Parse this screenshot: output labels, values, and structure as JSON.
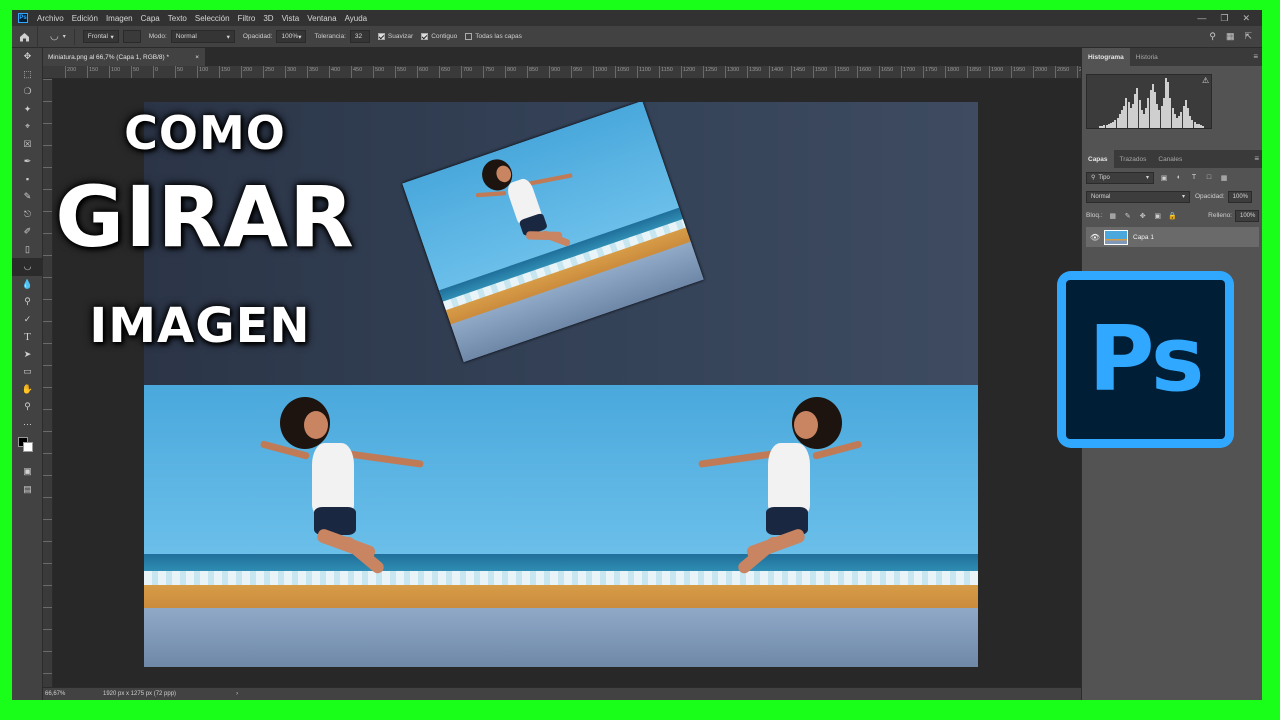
{
  "menubar": {
    "items": [
      "Archivo",
      "Edición",
      "Imagen",
      "Capa",
      "Texto",
      "Selección",
      "Filtro",
      "3D",
      "Vista",
      "Ventana",
      "Ayuda"
    ]
  },
  "options": {
    "mode_source": "Frontal",
    "mode_label": "Modo:",
    "mode_value": "Normal",
    "opacity_label": "Opacidad:",
    "opacity_value": "100%",
    "tolerance_label": "Tolerancia:",
    "tolerance_value": "32",
    "smooth_label": "Suavizar",
    "contiguous_label": "Contiguo",
    "all_layers_label": "Todas las capas"
  },
  "document": {
    "tab_title": "Miniatura.png al 66,7% (Capa 1, RGB/8) *",
    "tab_close": "×"
  },
  "ruler": {
    "ticks": [
      "200",
      "150",
      "100",
      "50",
      "0",
      "50",
      "100",
      "150",
      "200",
      "250",
      "300",
      "350",
      "400",
      "450",
      "500",
      "550",
      "600",
      "650",
      "700",
      "750",
      "800",
      "850",
      "900",
      "950",
      "1000",
      "1050",
      "1100",
      "1150",
      "1200",
      "1250",
      "1300",
      "1350",
      "1400",
      "1450",
      "1500",
      "1550",
      "1600",
      "1650",
      "1700",
      "1750",
      "1800",
      "1850",
      "1900",
      "1950",
      "2000",
      "2050",
      "2100"
    ]
  },
  "overlay": {
    "line1": "COMO",
    "line2": "GIRAR",
    "line3": "IMAGEN"
  },
  "logo": {
    "text": "Ps",
    "accent": "#31a8ff",
    "background": "#001e36"
  },
  "status": {
    "zoom": "66,67%",
    "info": "1920 px x 1275 px (72 ppp)",
    "arrow": "›"
  },
  "panels": {
    "top_tabs": [
      "Histograma",
      "Historia"
    ],
    "layer_tabs": [
      "Capas",
      "Trazados",
      "Canales"
    ],
    "filter_label": "Tipo",
    "blend_mode": "Normal",
    "opacity_label": "Opacidad:",
    "opacity_value": "100%",
    "lock_label": "Bloq.:",
    "fill_label": "Relleno:",
    "fill_value": "100%",
    "layer_name": "Capa 1"
  }
}
